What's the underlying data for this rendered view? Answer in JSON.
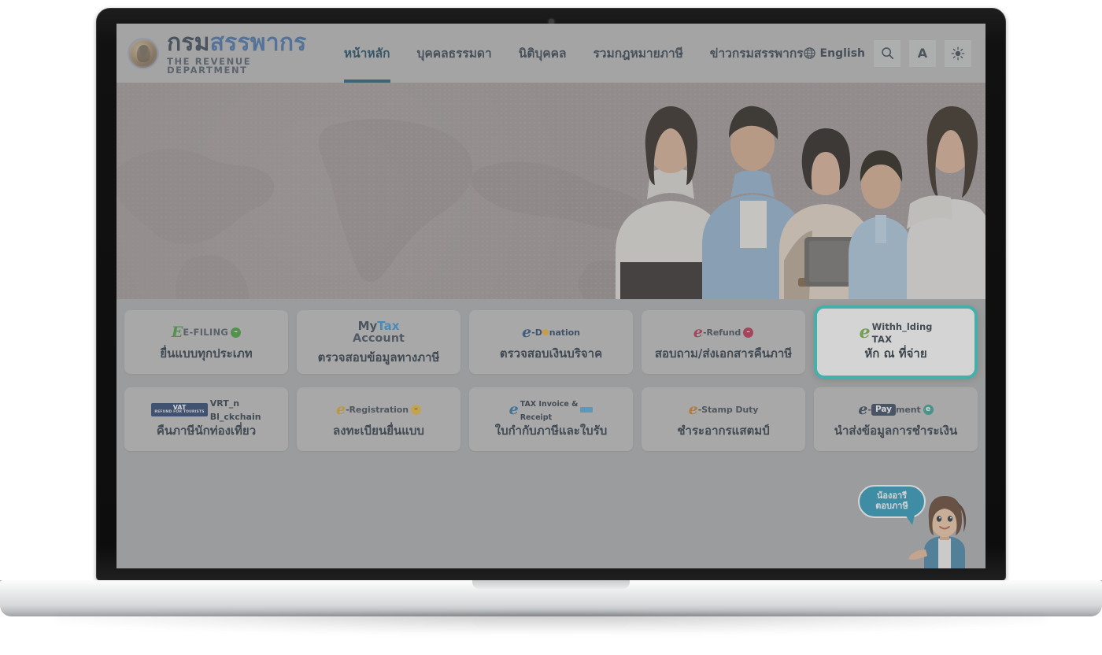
{
  "header": {
    "brand": {
      "seal_icon": "revenue-department-seal-icon",
      "thai_name_part1": "กรม",
      "thai_name_part2": "สรรพากร",
      "english_name": "THE REVENUE DEPARTMENT"
    },
    "nav": [
      {
        "label": "หน้าหลัก",
        "active": true
      },
      {
        "label": "บุคคลธรรมดา",
        "active": false
      },
      {
        "label": "นิติบุคคล",
        "active": false
      },
      {
        "label": "รวมกฎหมายภาษี",
        "active": false
      },
      {
        "label": "ข่าวกรมสรรพากร",
        "active": false
      }
    ],
    "tools": {
      "language_label": "English",
      "globe_icon": "globe-icon",
      "search_icon": "search-icon",
      "text_size_label": "A",
      "contrast_icon": "brightness-icon"
    },
    "active_underline_color": "#17586f"
  },
  "hero": {
    "alt": "family-group-photo-banner",
    "background_graphic": "world-map-globe"
  },
  "tiles": {
    "row1": [
      {
        "logo_name": "e-filing-logo",
        "logo_text": "E-FILING",
        "label": "ยื่นแบบทุกประเภท",
        "highlight": false
      },
      {
        "logo_name": "mytax-account-logo",
        "logo_text_line1a": "My",
        "logo_text_line1b": "Tax",
        "logo_text_line2": "Account",
        "label": "ตรวจสอบข้อมูลทางภาษี",
        "highlight": false
      },
      {
        "logo_name": "e-donation-logo",
        "logo_text": "-D_nation",
        "label": "ตรวจสอบเงินบริจาค",
        "highlight": false
      },
      {
        "logo_name": "e-refund-logo",
        "logo_text": "-Refund",
        "label": "สอบถาม/ส่งเอกสารคืนภาษี",
        "highlight": false
      },
      {
        "logo_name": "e-withholding-tax-logo",
        "logo_text_line1": "Withh_lding",
        "logo_text_line2": "TAX",
        "label": "หัก ณ ที่จ่าย",
        "highlight": true
      }
    ],
    "row2": [
      {
        "logo_name": "vrt-on-blockchain-logo",
        "chip": "VAT",
        "chip_sub": "REFUND FOR TOURISTS",
        "logo_text_line1": "VRT_n",
        "logo_text_line2": "Bl_ckchain",
        "label": "คืนภาษีนักท่องเที่ยว",
        "highlight": false
      },
      {
        "logo_name": "e-registration-logo",
        "logo_text": "-Registration",
        "label": "ลงทะเบียนยื่นแบบ",
        "highlight": false
      },
      {
        "logo_name": "e-tax-invoice-receipt-logo",
        "logo_text_line1": "TAX Invoice &",
        "logo_text_line2": "Receipt",
        "label": "ใบกำกับภาษีและใบรับ",
        "highlight": false
      },
      {
        "logo_name": "e-stamp-duty-logo",
        "logo_text": "-Stamp Duty",
        "label": "ชำระอากรแสตมป์",
        "highlight": false
      },
      {
        "logo_name": "e-payment-logo",
        "logo_text_pre": "-",
        "logo_text_pill": "Pay",
        "logo_text_post": "ment",
        "label": "นำส่งข้อมูลการชำระเงิน",
        "highlight": false
      }
    ],
    "highlight_border_color": "#25c8c0"
  },
  "chatbot": {
    "name": "nong-aree-chatbot",
    "bubble_line1": "น้องอารี",
    "bubble_line2": "ตอบภาษี",
    "bubble_color": "#1e93b8"
  },
  "device": {
    "type": "laptop-mockup",
    "camera_icon": "webcam-dot-icon"
  }
}
